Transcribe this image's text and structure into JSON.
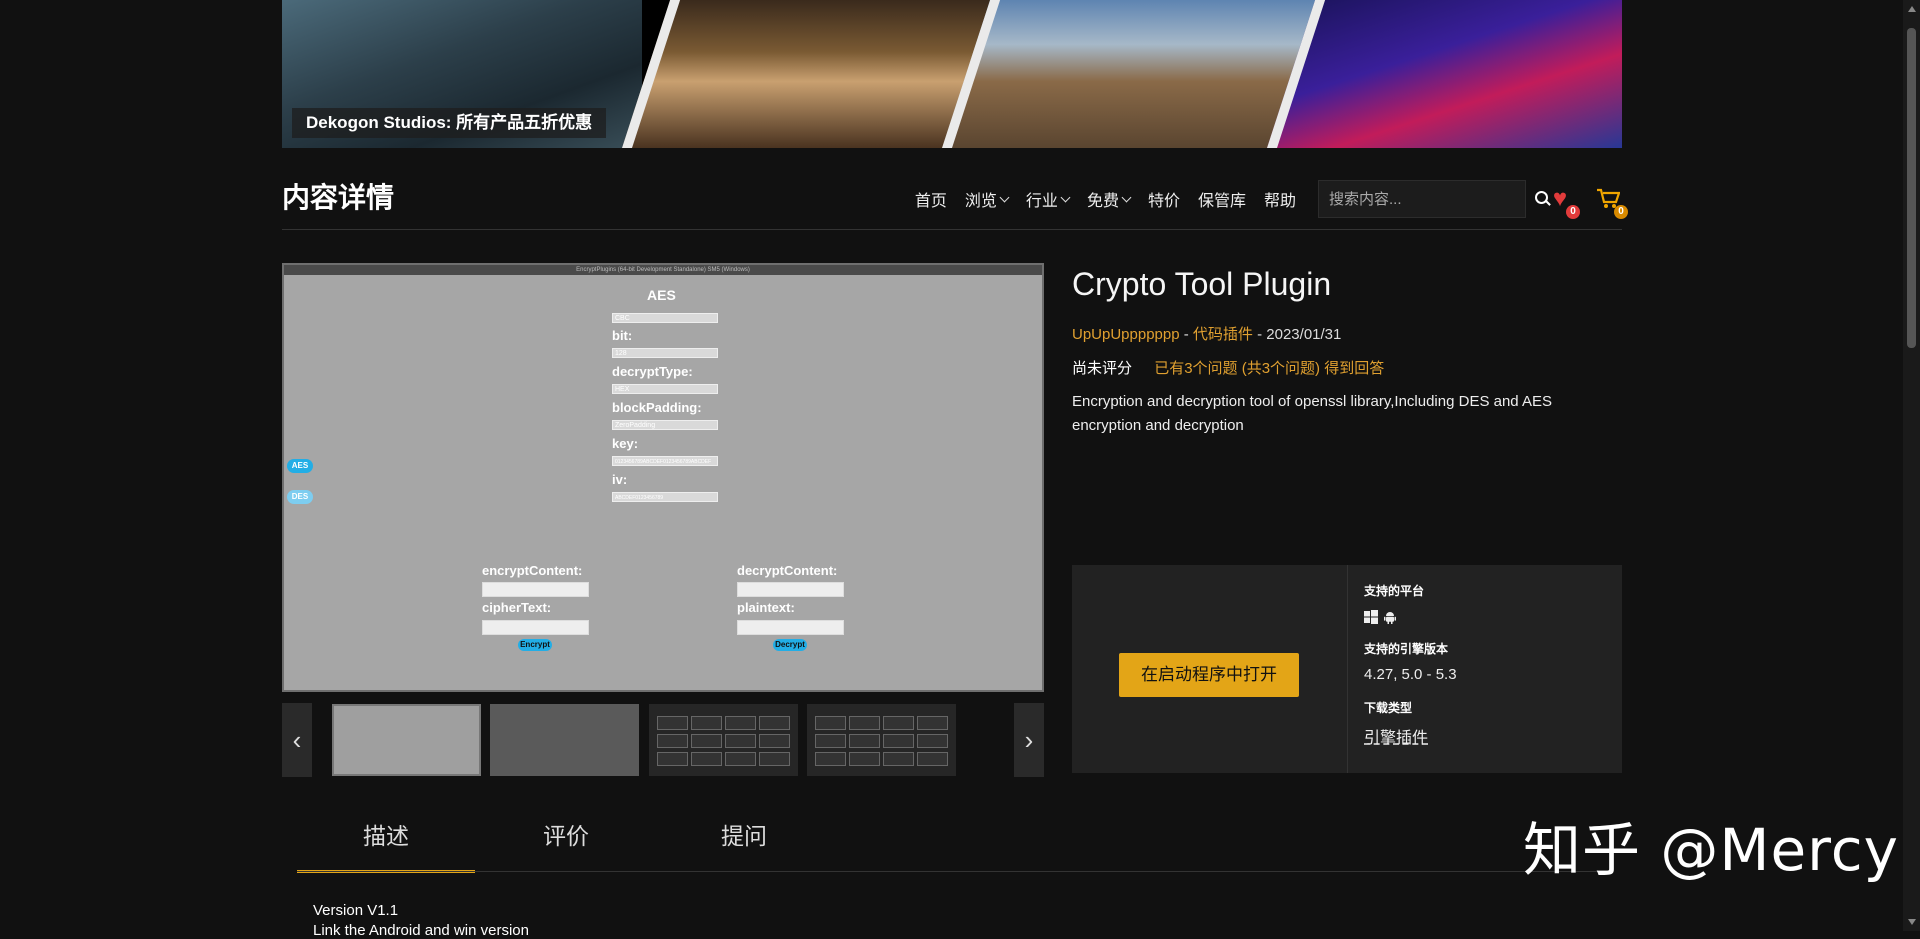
{
  "banner": {
    "label": "Dekogon Studios: 所有产品五折优惠"
  },
  "header": {
    "title": "内容详情",
    "nav": [
      {
        "label": "首页",
        "dropdown": false
      },
      {
        "label": "浏览",
        "dropdown": true
      },
      {
        "label": "行业",
        "dropdown": true
      },
      {
        "label": "免费",
        "dropdown": true
      },
      {
        "label": "特价",
        "dropdown": false
      },
      {
        "label": "保管库",
        "dropdown": false
      },
      {
        "label": "帮助",
        "dropdown": false
      }
    ],
    "search": {
      "placeholder": "搜索内容...",
      "icon": "search-icon"
    },
    "wishlist_count": "0",
    "cart_count": "0",
    "colors": {
      "heart": "#e23b3b",
      "cart": "#f0a500"
    }
  },
  "gallery": {
    "screenshot": {
      "window_title": "EncryptPlugins (64-bit Development Standalone) SM5 (Windows)",
      "title": "AES",
      "fields": [
        {
          "label": "",
          "value": "CBC"
        },
        {
          "label": "bit:",
          "value": "128"
        },
        {
          "label": "decryptType:",
          "value": "HEX"
        },
        {
          "label": "blockPadding:",
          "value": "ZeroPadding"
        },
        {
          "label": "key:",
          "value": "0123456789ABCDEF0123456789ABCDEF"
        },
        {
          "label": "iv:",
          "value": "ABCDEF0123456789"
        }
      ],
      "tab_aes": "AES",
      "tab_des": "DES",
      "encrypt_content_label": "encryptContent:",
      "cipher_text_label": "cipherText:",
      "encrypt_button": "Encrypt",
      "decrypt_content_label": "decryptContent:",
      "plaintext_label": "plaintext:",
      "decrypt_button": "Decrypt"
    },
    "prev_icon": "chevron-left-icon",
    "next_icon": "chevron-right-icon",
    "thumbnail_count": 4
  },
  "product": {
    "title": "Crypto Tool Plugin",
    "author": "UpUpUppppppp",
    "category": "代码插件",
    "date": "2023/01/31",
    "rating_text": "尚未评分",
    "qa_text": "已有3个问题 (共3个问题) 得到回答",
    "description": "Encryption and decryption tool of openssl library,Including DES and AES encryption and decryption",
    "accent_color": "#e0a030"
  },
  "purchase": {
    "open_button": "在启动程序中打开",
    "platforms_label": "支持的平台",
    "platforms": [
      "windows-icon",
      "android-icon"
    ],
    "engine_label": "支持的引擎版本",
    "engine_versions": "4.27, 5.0 - 5.3",
    "download_type_label": "下载类型",
    "download_type": "引擎插件",
    "button_color": "#e3a517"
  },
  "tabs": [
    {
      "label": "描述",
      "active": true
    },
    {
      "label": "评价",
      "active": false
    },
    {
      "label": "提问",
      "active": false
    }
  ],
  "content": {
    "version": "Version V1.1",
    "line2": "Link the Android and win version"
  },
  "watermark": "知乎 @Mercy"
}
